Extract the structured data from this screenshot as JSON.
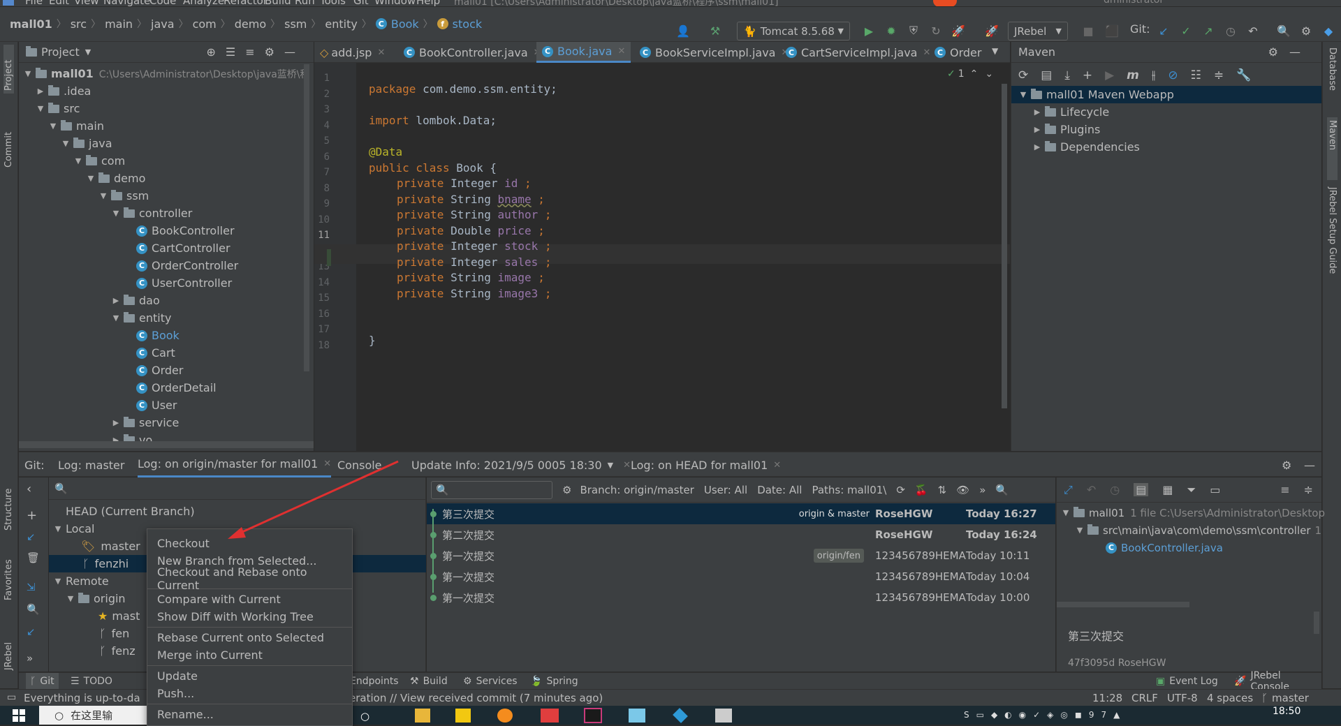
{
  "menu": [
    "File",
    "Edit",
    "View",
    "Navigate",
    "Code",
    "Analyze",
    "Refactor",
    "Build",
    "Run",
    "Tools",
    "Git",
    "Window",
    "Help"
  ],
  "window_title_fragment": "mall01 [C:\\Users\\Administrator\\Desktop\\java蓝桥\\程序\\ssm\\mall01]",
  "window_title_user": "dministrator",
  "breadcrumb": [
    "mall01",
    "src",
    "main",
    "java",
    "com",
    "demo",
    "ssm",
    "entity",
    "Book",
    "stock"
  ],
  "toolbar": {
    "run_config": "Tomcat 8.5.68",
    "jrebel": "JRebel",
    "git_label": "Git:"
  },
  "project_panel": {
    "title": "Project",
    "root": "mall01",
    "root_path": "C:\\Users\\Administrator\\Desktop\\java蓝桥\\程",
    "tree": [
      {
        "label": "mall01",
        "kind": "root"
      },
      {
        "label": ".idea",
        "kind": "folder"
      },
      {
        "label": "src",
        "kind": "folder"
      },
      {
        "label": "main",
        "kind": "folder"
      },
      {
        "label": "java",
        "kind": "folder"
      },
      {
        "label": "com",
        "kind": "folder"
      },
      {
        "label": "demo",
        "kind": "folder"
      },
      {
        "label": "ssm",
        "kind": "folder"
      },
      {
        "label": "controller",
        "kind": "folder"
      },
      {
        "label": "BookController",
        "kind": "class"
      },
      {
        "label": "CartController",
        "kind": "class"
      },
      {
        "label": "OrderController",
        "kind": "class"
      },
      {
        "label": "UserController",
        "kind": "class"
      },
      {
        "label": "dao",
        "kind": "folder"
      },
      {
        "label": "entity",
        "kind": "folder"
      },
      {
        "label": "Book",
        "kind": "class"
      },
      {
        "label": "Cart",
        "kind": "class"
      },
      {
        "label": "Order",
        "kind": "class"
      },
      {
        "label": "OrderDetail",
        "kind": "class"
      },
      {
        "label": "User",
        "kind": "class"
      },
      {
        "label": "service",
        "kind": "folder"
      },
      {
        "label": "vo",
        "kind": "folder"
      }
    ]
  },
  "editor": {
    "tabs": [
      "add.jsp",
      "BookController.java",
      "Book.java",
      "BookServiceImpl.java",
      "CartServiceImpl.java",
      "Order"
    ],
    "active_tab": "Book.java",
    "inspection_count": "1",
    "line_numbers": [
      "1",
      "2",
      "3",
      "4",
      "5",
      "6",
      "7",
      "8",
      "9",
      "10",
      "11",
      "12",
      "13",
      "14",
      "15",
      "16",
      "17",
      "18"
    ],
    "lines": {
      "l1_kw": "package",
      "l1_rest": " com.demo.ssm.entity;",
      "l3_kw": "import",
      "l3_rest": " lombok.Data;",
      "l5_ann": "@Data",
      "l6_kw": "public class",
      "l6_rest": " Book {",
      "l7_kw": "private",
      "l7_type": " Integer ",
      "l7_fld": "id",
      "l7_end": " ;",
      "l8_kw": "private",
      "l8_type": " String ",
      "l8_fld": "bname",
      "l8_end": " ;",
      "l9_kw": "private",
      "l9_type": " String ",
      "l9_fld": "author",
      "l9_end": " ;",
      "l10_kw": "private",
      "l10_type": " Double ",
      "l10_fld": "price",
      "l10_end": " ;",
      "l11_kw": "private",
      "l11_type": " Integer ",
      "l11_fld": "stock",
      "l11_end": " ;",
      "l12_kw": "private",
      "l12_type": " Integer ",
      "l12_fld": "sales",
      "l12_end": " ;",
      "l13_kw": "private",
      "l13_type": " String ",
      "l13_fld": "image",
      "l13_end": " ;",
      "l14_kw": "private",
      "l14_type": " String ",
      "l14_fld": "image3",
      "l14_end": " ;",
      "l17": "}"
    }
  },
  "maven": {
    "title": "Maven",
    "project": "mall01 Maven Webapp",
    "items": [
      "Lifecycle",
      "Plugins",
      "Dependencies"
    ]
  },
  "left_strip": [
    "Project",
    "Commit",
    "Structure",
    "Favorites",
    "JRebel"
  ],
  "right_strip": [
    "Database",
    "Maven",
    "JRebel Setup Guide"
  ],
  "bottom": {
    "label": "Git:",
    "tabs": [
      "Log: master",
      "Log: on origin/master for mall01",
      "Console",
      "Update Info: 2021/9/5 0005 18:30",
      "Log: on HEAD for mall01"
    ],
    "active_tab": "Log: on origin/master for mall01"
  },
  "branches": {
    "head": "HEAD (Current Branch)",
    "local": "Local",
    "local_items": [
      "master",
      "fenzhi"
    ],
    "remote": "Remote",
    "origin": "origin",
    "remote_items": [
      "mast",
      "fen",
      "fenz"
    ]
  },
  "log_filters": {
    "branch": "Branch: origin/master",
    "user": "User: All",
    "date": "Date: All",
    "paths": "Paths: mall01\\"
  },
  "commits": [
    {
      "msg": "第三次提交",
      "refs": "origin & master",
      "author": "RoseHGW",
      "date": "Today 16:27",
      "bold": true
    },
    {
      "msg": "第二次提交",
      "refs": "",
      "author": "RoseHGW",
      "date": "Today 16:24",
      "bold": true
    },
    {
      "msg": "第一次提交",
      "refs": "origin/fen",
      "author": "123456789HEMA",
      "date": "Today 10:11",
      "bold": false
    },
    {
      "msg": "第一次提交",
      "refs": "",
      "author": "123456789HEMA",
      "date": "Today 10:04",
      "bold": false
    },
    {
      "msg": "第一次提交",
      "refs": "",
      "author": "123456789HEMA",
      "date": "Today 10:00",
      "bold": false
    }
  ],
  "details": {
    "root": "mall01",
    "root_info": "1 file  C:\\Users\\Administrator\\Desktop",
    "path": "src\\main\\java\\com\\demo\\ssm\\controller",
    "path_count": "1",
    "file": "BookController.java",
    "commit_msg": "第三次提交",
    "commit_hash": "47f3095d RoseHGW"
  },
  "context_menu": {
    "groups": [
      [
        "Checkout",
        "New Branch from Selected...",
        "Checkout and Rebase onto Current"
      ],
      [
        "Compare with Current",
        "Show Diff with Working Tree"
      ],
      [
        "Rebase Current onto Selected",
        "Merge into Current"
      ],
      [
        "Update",
        "Push..."
      ],
      [
        "Rename..."
      ]
    ]
  },
  "tool_windows": [
    "Git",
    "TODO",
    "Endpoints",
    "Build",
    "Services",
    "Spring",
    "Event Log",
    "JRebel Console"
  ],
  "status": {
    "left": "Everything is up-to-da",
    "middle": "eration // View received commit (7 minutes ago)",
    "position": "11:28",
    "line_sep": "CRLF",
    "encoding": "UTF-8",
    "indent": "4 spaces",
    "branch": "master"
  },
  "taskbar": {
    "search": "在这里输",
    "clock": "18:50"
  },
  "colors": {
    "accent": "#4a88c7",
    "keyword": "#cc7832",
    "field": "#9876aa",
    "annotation": "#bbb529",
    "class_icon": "#3592c4",
    "graph_green": "#5a9e6f",
    "arrow_red": "#e03030"
  }
}
